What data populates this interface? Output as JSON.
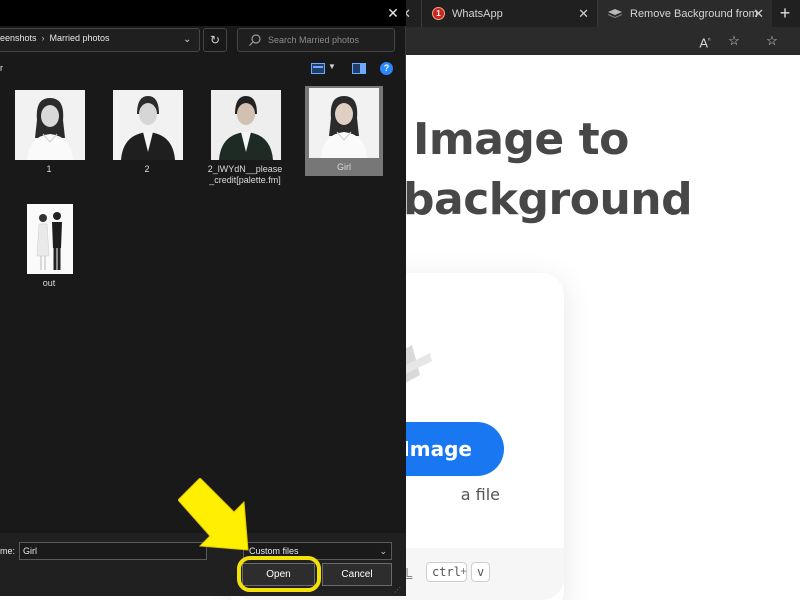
{
  "browser": {
    "tabs": [
      {
        "label": "",
        "icon": "remove-background-favicon"
      },
      {
        "label": "WhatsApp",
        "icon": "whatsapp-favicon",
        "notification_badge": "1"
      },
      {
        "label": "Remove Background from Im",
        "icon": "remove-background-favicon"
      }
    ],
    "toolbar_icons": [
      "read-aloud-icon",
      "add-favorite-icon",
      "favorites-icon"
    ],
    "read_aloud_text": "A",
    "page": {
      "hero_title_line1": "Image to",
      "hero_title_line2": "background",
      "upload_button": "Image",
      "drop_text": "a file",
      "paste_url_label": "RL",
      "shortcut_ctrl": "ctrl",
      "shortcut_plus": "+",
      "shortcut_v": "v",
      "accent_color": "#1977f2"
    }
  },
  "dialog": {
    "breadcrumb": [
      "eenshots",
      "Married photos"
    ],
    "search_placeholder": "Search Married photos",
    "organize_label": "r",
    "files": [
      {
        "name": "1",
        "selected": false
      },
      {
        "name": "2",
        "selected": false
      },
      {
        "name": "2_lWYdN__please_credit[palette.fm]",
        "selected": false
      },
      {
        "name": "Girl",
        "selected": true
      },
      {
        "name": "out",
        "selected": false
      }
    ],
    "file_name_label": "me:",
    "file_name_value": "Girl",
    "file_type": "Custom files",
    "open_label": "Open",
    "cancel_label": "Cancel",
    "highlight_color": "#f5e10a"
  }
}
